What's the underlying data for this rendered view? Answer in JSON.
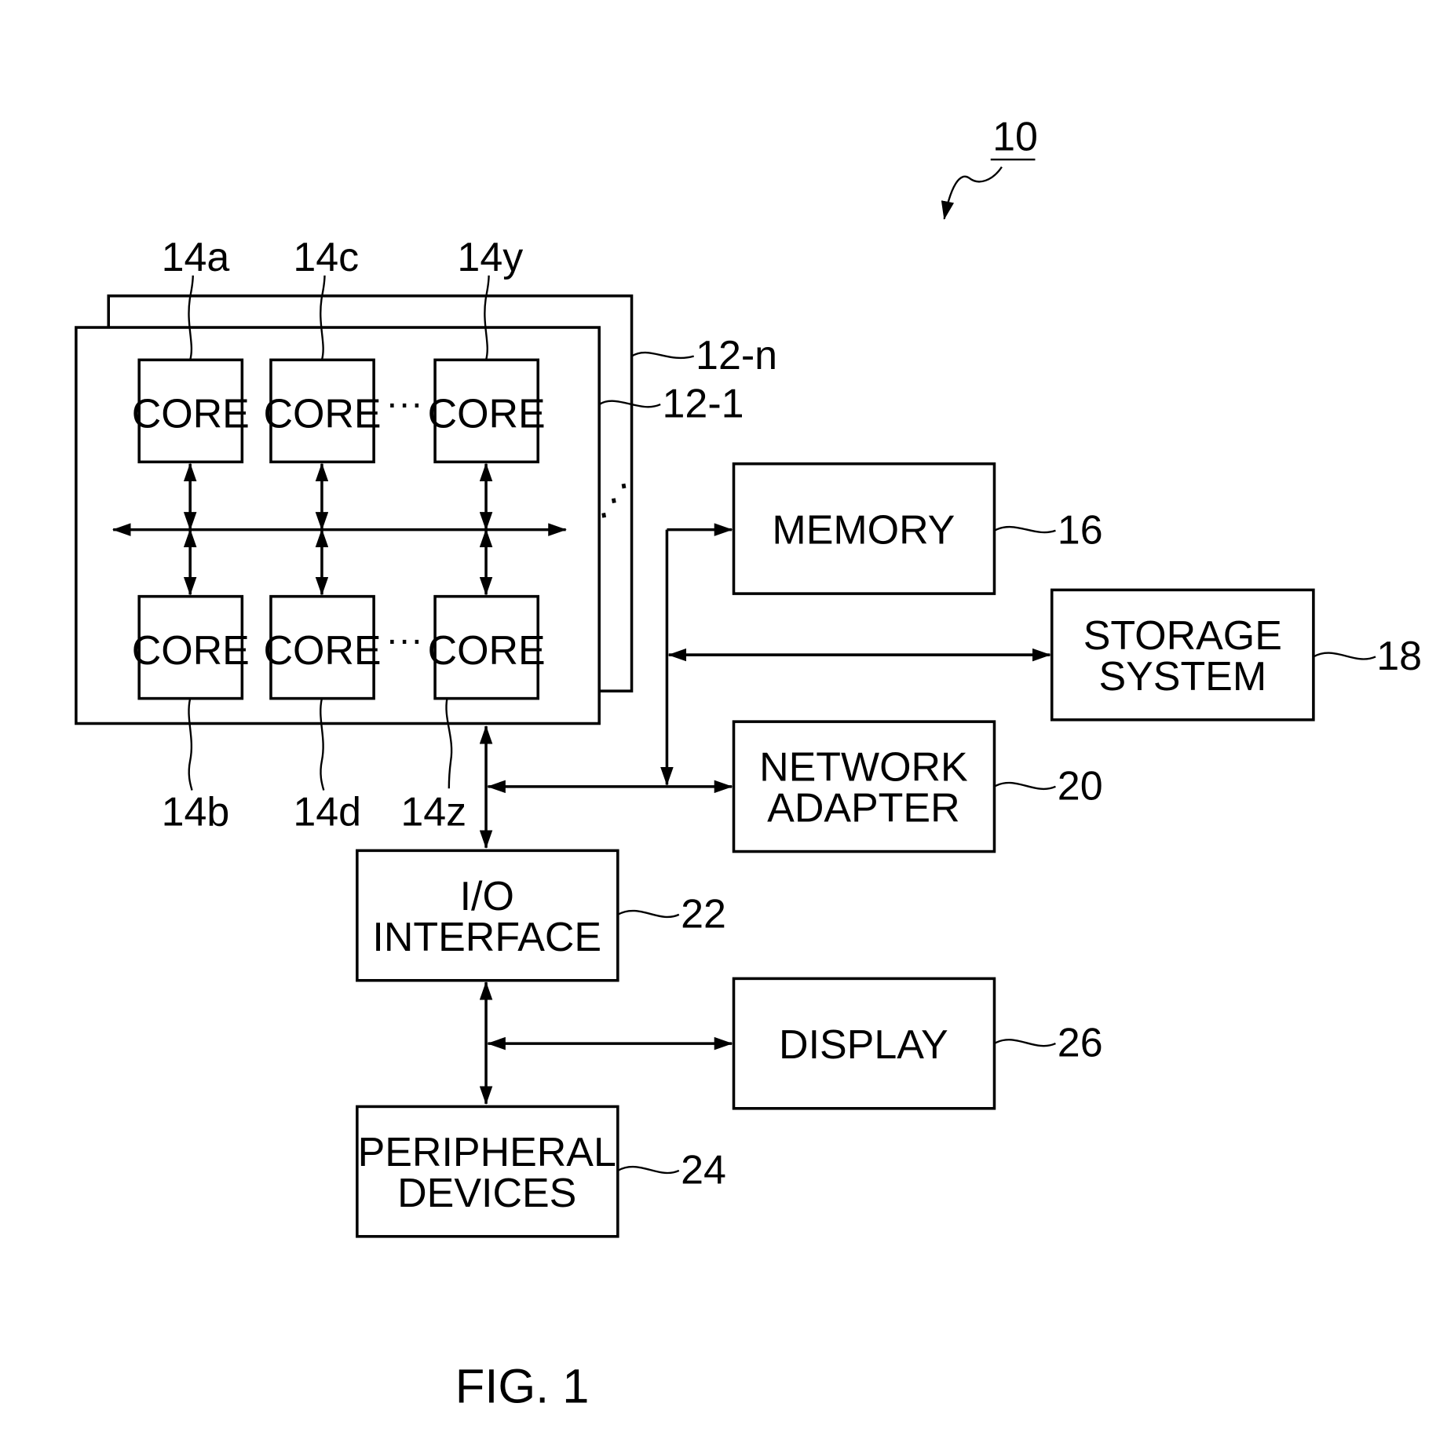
{
  "figure": {
    "caption": "FIG. 1",
    "system_ref": "10"
  },
  "processors": {
    "front_ref": "12-1",
    "back_ref": "12-n",
    "stack_ellipsis": "⋰",
    "core_label": "CORE",
    "row_ellipsis": "···",
    "cores_top": [
      {
        "ref": "14a",
        "label": "CORE"
      },
      {
        "ref": "14c",
        "label": "CORE"
      },
      {
        "ref": "14y",
        "label": "CORE"
      }
    ],
    "cores_bottom": [
      {
        "ref": "14b",
        "label": "CORE"
      },
      {
        "ref": "14d",
        "label": "CORE"
      },
      {
        "ref": "14z",
        "label": "CORE"
      }
    ]
  },
  "blocks": {
    "memory": {
      "lines": [
        "MEMORY"
      ],
      "ref": "16"
    },
    "storage": {
      "lines": [
        "STORAGE",
        "SYSTEM"
      ],
      "ref": "18"
    },
    "network": {
      "lines": [
        "NETWORK",
        "ADAPTER"
      ],
      "ref": "20"
    },
    "io": {
      "lines": [
        "I/O",
        "INTERFACE"
      ],
      "ref": "22"
    },
    "peripheral": {
      "lines": [
        "PERIPHERAL",
        "DEVICES"
      ],
      "ref": "24"
    },
    "display": {
      "lines": [
        "DISPLAY"
      ],
      "ref": "26"
    }
  }
}
